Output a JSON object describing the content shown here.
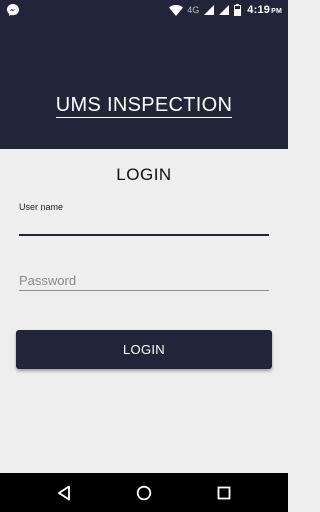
{
  "status_bar": {
    "network_label": "4G",
    "time": "4:19",
    "time_suffix": "PM",
    "icons": [
      "messenger-icon",
      "wifi-icon",
      "signal-icon",
      "signal-icon",
      "battery-icon"
    ]
  },
  "header": {
    "title": "UMS INSPECTION",
    "background_color": "#22253a"
  },
  "login_form": {
    "heading": "LOGIN",
    "username_label": "User name",
    "username_value": "",
    "password_placeholder": "Password",
    "password_value": "",
    "submit_label": "LOGIN",
    "accent_color": "#22253a"
  },
  "nav_bar": {
    "icons": [
      "back-icon",
      "home-icon",
      "recents-icon"
    ]
  }
}
